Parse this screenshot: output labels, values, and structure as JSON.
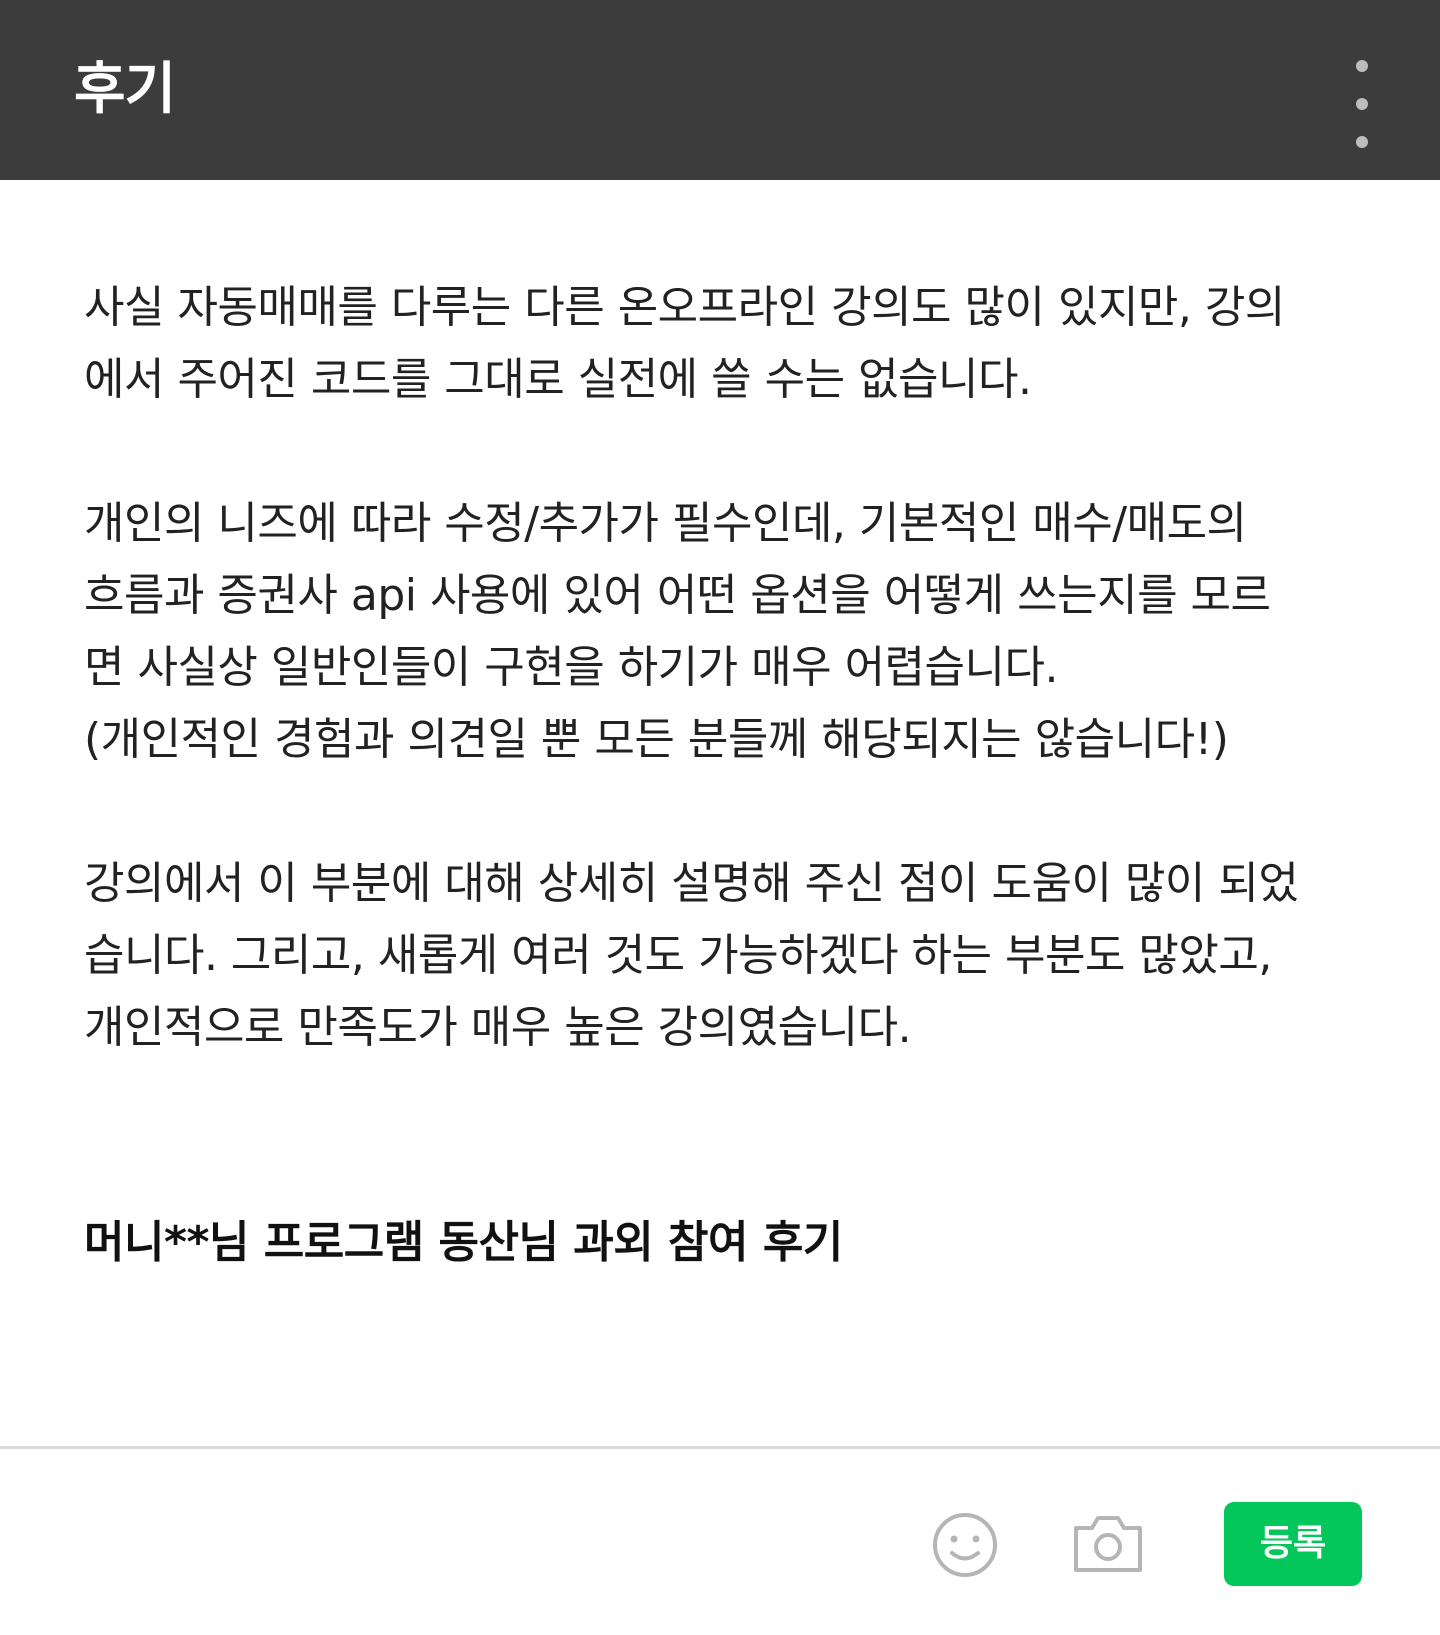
{
  "header": {
    "title": "후기",
    "more_icon": "more-vertical-icon"
  },
  "body": {
    "paragraphs": [
      {
        "lines": [
          "사실 자동매매를 다루는 다른 온오프라인 강의도 많이 있지만, 강의",
          "에서 주어진 코드를 그대로 실전에 쓸 수는 없습니다."
        ]
      },
      {
        "lines": [
          "개인의 니즈에 따라 수정/추가가 필수인데, 기본적인 매수/매도의",
          "흐름과 증권사 api 사용에 있어 어떤 옵션을 어떻게 쓰는지를 모르",
          "면 사실상 일반인들이 구현을 하기가 매우 어렵습니다.",
          "(개인적인 경험과 의견일 뿐 모든 분들께 해당되지는 않습니다!)"
        ]
      },
      {
        "lines": [
          "강의에서 이 부분에 대해 상세히 설명해 주신 점이 도움이 많이 되었",
          "습니다. 그리고, 새롭게 여러 것도 가능하겠다 하는 부분도 많았고,",
          "개인적으로 만족도가 매우 높은 강의였습니다."
        ]
      }
    ],
    "bold_line": "머니**님 프로그램 동산님 과외 참여 후기"
  },
  "toolbar": {
    "emoji_icon": "smiley-icon",
    "camera_icon": "camera-icon",
    "submit_label": "등록",
    "accent_color": "#03c75a"
  }
}
